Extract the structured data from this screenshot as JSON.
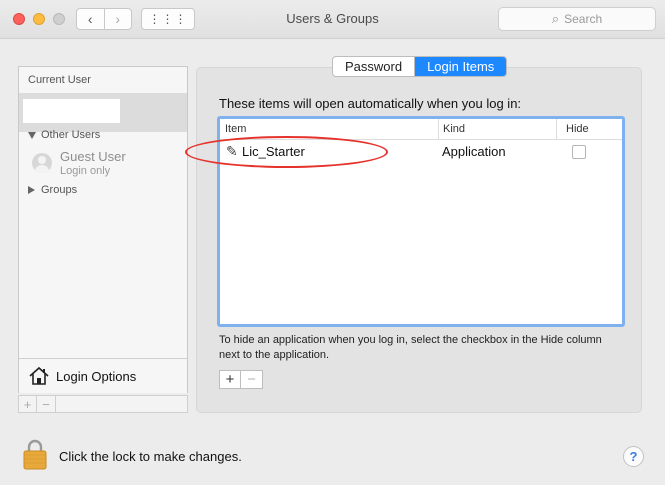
{
  "window": {
    "title": "Users & Groups"
  },
  "toolbar": {
    "back_icon": "chevron-left-icon",
    "forward_icon": "chevron-right-icon",
    "grid_icon": "grid-icon",
    "search_placeholder": "Search"
  },
  "sidebar": {
    "current_user_heading": "Current User",
    "other_users_heading": "Other Users",
    "guest_name": "Guest User",
    "guest_sub": "Login only",
    "groups_label": "Groups",
    "login_options_label": "Login Options",
    "add_label": "+",
    "remove_label": "−"
  },
  "tabs": [
    {
      "label": "Password",
      "active": false
    },
    {
      "label": "Login Items",
      "active": true
    }
  ],
  "main": {
    "intro": "These items will open automatically when you log in:",
    "columns": {
      "item": "Item",
      "kind": "Kind",
      "hide": "Hide"
    },
    "rows": [
      {
        "name": "Lic_Starter",
        "kind": "Application",
        "hide": false
      }
    ],
    "hint": "To hide an application when you log in, select the checkbox in the Hide column next to the application.",
    "add_label": "+",
    "remove_label": "−"
  },
  "footer": {
    "lock_text": "Click the lock to make changes.",
    "help_label": "?"
  },
  "colors": {
    "accent": "#1e88ff",
    "focus_ring": "#7fb1ee",
    "annotation": "#e5322b"
  }
}
